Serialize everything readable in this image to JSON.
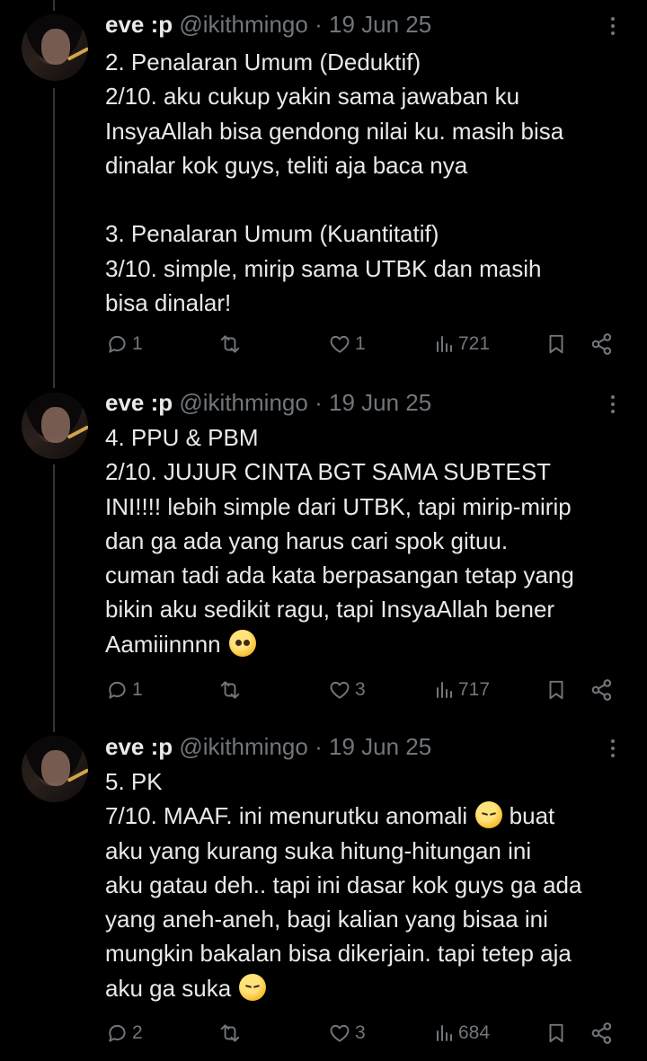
{
  "tweets": [
    {
      "author": {
        "name": "eve :p",
        "handle": "@ikithmingo"
      },
      "separator": "·",
      "date": "19 Jun 25",
      "lines": [
        "2. Penalaran Umum (Deduktif)",
        "2/10. aku cukup yakin sama jawaban ku",
        "InsyaAllah bisa gendong nilai ku. masih bisa",
        "dinalar kok guys, teliti aja baca nya",
        "",
        "3. Penalaran Umum (Kuantitatif)",
        "3/10. simple, mirip sama UTBK dan masih",
        "bisa dinalar!"
      ],
      "stats": {
        "replies": "1",
        "retweets": "",
        "likes": "1",
        "views": "721"
      }
    },
    {
      "author": {
        "name": "eve :p",
        "handle": "@ikithmingo"
      },
      "separator": "·",
      "date": "19 Jun 25",
      "lines": [
        "4. PPU & PBM",
        "2/10. JUJUR CINTA BGT SAMA SUBTEST",
        "INI!!!! lebih simple dari UTBK, tapi mirip-mirip",
        "dan ga ada yang harus cari spok gituu.",
        "cuman tadi ada kata berpasangan tetap yang",
        "bikin aku sedikit ragu, tapi InsyaAllah bener",
        "Aamiiinnnn"
      ],
      "emojis": [
        "pleading-face"
      ],
      "stats": {
        "replies": "1",
        "retweets": "",
        "likes": "3",
        "views": "717"
      }
    },
    {
      "author": {
        "name": "eve :p",
        "handle": "@ikithmingo"
      },
      "separator": "·",
      "date": "19 Jun 25",
      "lines": [
        "5. PK",
        "7/10. MAAF. ini menurutku anomali",
        "aku yang kurang suka hitung-hitungan ini",
        "aku gatau deh.. tapi ini dasar kok guys ga ada",
        "yang aneh-aneh, bagi kalian yang bisaa ini",
        "mungkin bakalan bisa dikerjain. tapi tetep aja",
        "aku ga suka"
      ],
      "line2_tail": "buat",
      "emojis": [
        "pensive-face",
        "pensive-face"
      ],
      "stats": {
        "replies": "2",
        "retweets": "",
        "likes": "3",
        "views": "684"
      }
    }
  ],
  "colors": {
    "background": "#000000",
    "text": "#e7e9ea",
    "muted": "#71767b",
    "thread_line": "#333639"
  }
}
